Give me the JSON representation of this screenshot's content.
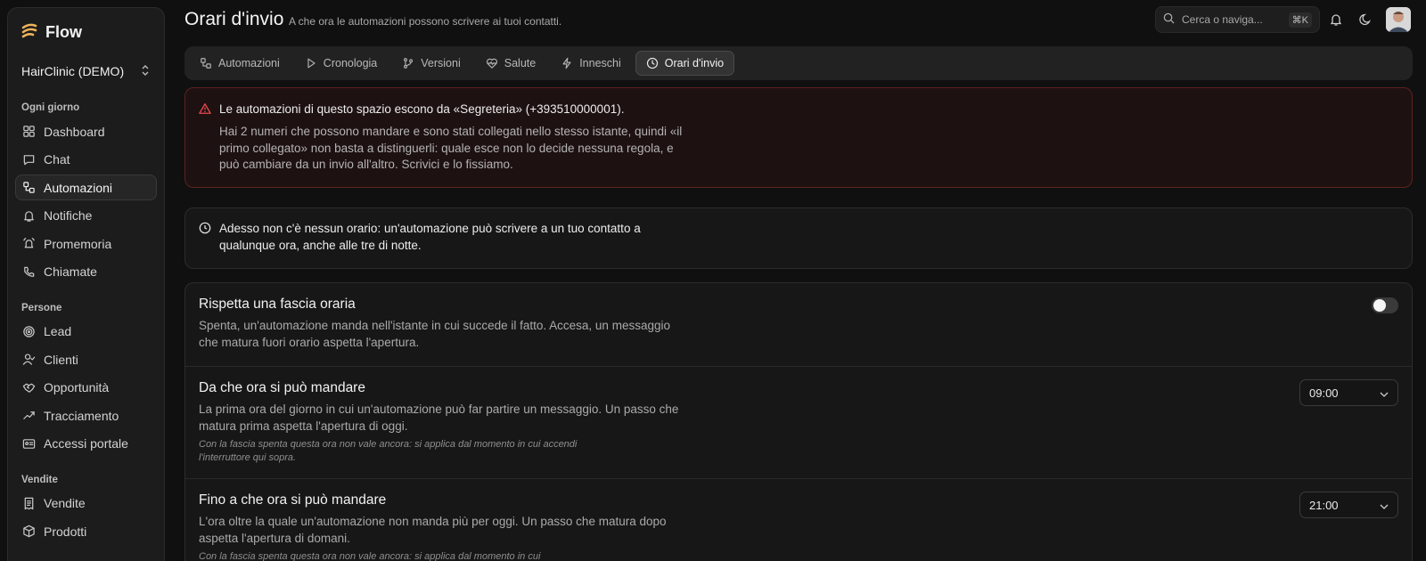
{
  "app": {
    "name": "Flow"
  },
  "workspace": {
    "name": "HairClinic (DEMO)"
  },
  "sidebar": {
    "sections": [
      {
        "label": "Ogni giorno",
        "items": [
          {
            "label": "Dashboard",
            "icon": "dashboard-icon"
          },
          {
            "label": "Chat",
            "icon": "chat-icon"
          },
          {
            "label": "Automazioni",
            "icon": "workflow-icon",
            "active": true
          },
          {
            "label": "Notifiche",
            "icon": "bell-icon"
          },
          {
            "label": "Promemoria",
            "icon": "bell-ring-icon"
          },
          {
            "label": "Chiamate",
            "icon": "phone-icon"
          }
        ]
      },
      {
        "label": "Persone",
        "items": [
          {
            "label": "Lead",
            "icon": "target-icon"
          },
          {
            "label": "Clienti",
            "icon": "user-check-icon"
          },
          {
            "label": "Opportunità",
            "icon": "handshake-icon"
          },
          {
            "label": "Tracciamento",
            "icon": "trend-icon"
          },
          {
            "label": "Accessi portale",
            "icon": "id-card-icon"
          }
        ]
      },
      {
        "label": "Vendite",
        "items": [
          {
            "label": "Vendite",
            "icon": "receipt-icon"
          },
          {
            "label": "Prodotti",
            "icon": "package-icon"
          }
        ]
      }
    ]
  },
  "header": {
    "title": "Orari d'invio",
    "subtitle": "A che ora le automazioni possono scrivere ai tuoi contatti.",
    "search_placeholder": "Cerca o naviga...",
    "search_shortcut": "⌘K"
  },
  "tabs": [
    {
      "label": "Automazioni",
      "icon": "workflow-icon"
    },
    {
      "label": "Cronologia",
      "icon": "play-icon"
    },
    {
      "label": "Versioni",
      "icon": "git-branch-icon"
    },
    {
      "label": "Salute",
      "icon": "heart-pulse-icon"
    },
    {
      "label": "Inneschi",
      "icon": "zap-icon"
    },
    {
      "label": "Orari d'invio",
      "icon": "clock-icon",
      "active": true
    }
  ],
  "warning": {
    "title": "Le automazioni di questo spazio escono da «Segreteria» (+393510000001).",
    "body": "Hai 2 numeri che possono mandare e sono stati collegati nello stesso istante, quindi «il primo collegato» non basta a distinguerli: quale esce non lo decide nessuna regola, e può cambiare da un invio all'altro. Scrivici e lo fissiamo."
  },
  "info": {
    "text": "Adesso non c'è nessun orario: un'automazione può scrivere a un tuo contatto a qualunque ora, anche alle tre di notte."
  },
  "settings": {
    "window": {
      "title": "Rispetta una fascia oraria",
      "desc": "Spenta, un'automazione manda nell'istante in cui succede il fatto. Accesa, un messaggio che matura fuori orario aspetta l'apertura.",
      "enabled": false
    },
    "start": {
      "title": "Da che ora si può mandare",
      "desc": "La prima ora del giorno in cui un'automazione può far partire un messaggio. Un passo che matura prima aspetta l'apertura di oggi.",
      "note": "Con la fascia spenta questa ora non vale ancora: si applica dal momento in cui accendi l'interruttore qui sopra.",
      "value": "09:00"
    },
    "end": {
      "title": "Fino a che ora si può mandare",
      "desc": "L'ora oltre la quale un'automazione non manda più per oggi. Un passo che matura dopo aspetta l'apertura di domani.",
      "note": "Con la fascia spenta questa ora non vale ancora: si applica dal momento in cui",
      "value": "21:00"
    }
  },
  "colors": {
    "warning_border": "#5b2222",
    "warning_icon": "#e5484d",
    "background": "#101010"
  }
}
